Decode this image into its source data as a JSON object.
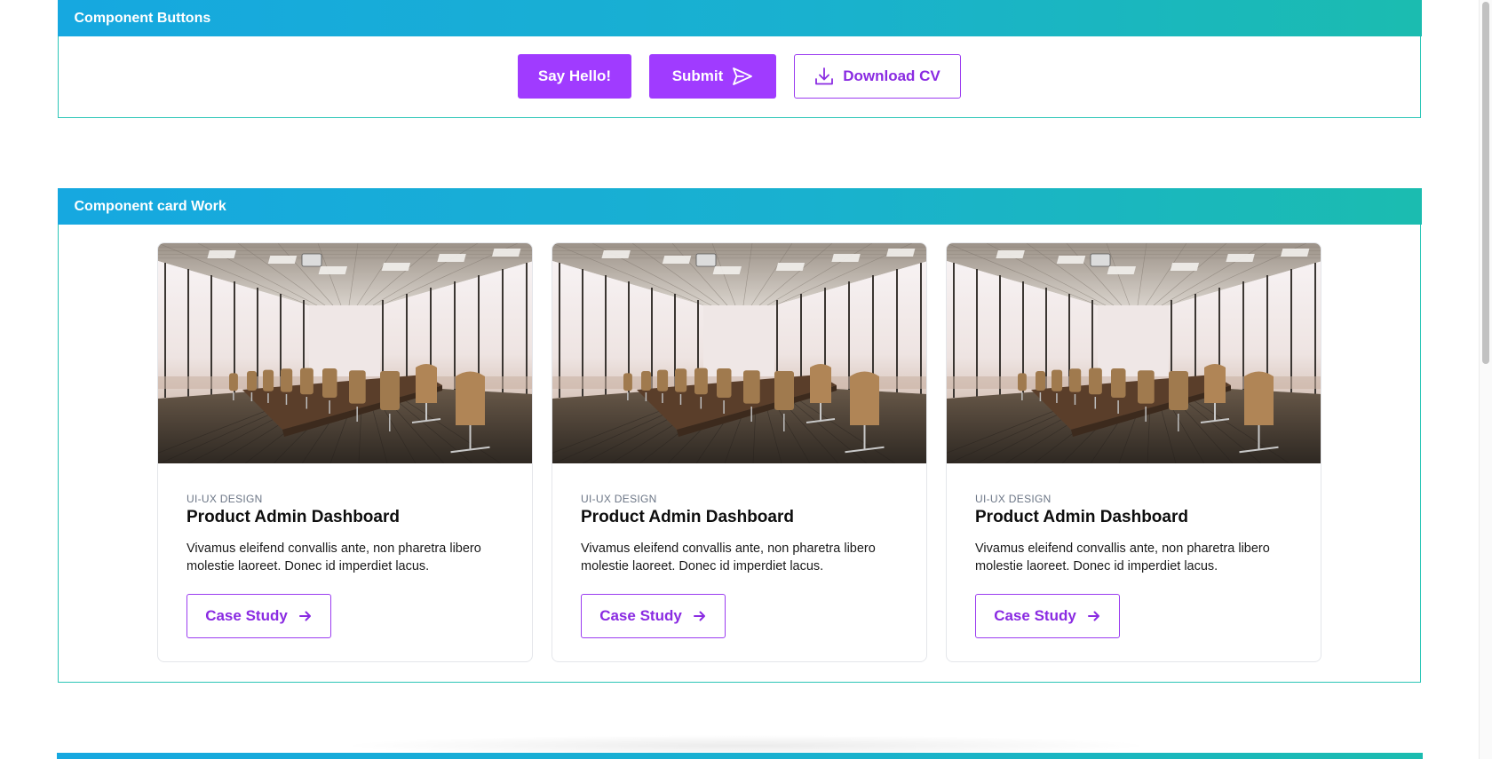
{
  "sections": {
    "buttons": {
      "title": "Component Buttons",
      "say_hello_label": "Say Hello!",
      "submit_label": "Submit",
      "download_label": "Download CV"
    },
    "cards": {
      "title": "Component card Work",
      "items": [
        {
          "category": "UI-UX DESIGN",
          "title": "Product Admin Dashboard",
          "text": "Vivamus eleifend convallis ante, non pharetra libero molestie laoreet. Donec id imperdiet lacus.",
          "button_label": "Case Study"
        },
        {
          "category": "UI-UX DESIGN",
          "title": "Product Admin Dashboard",
          "text": "Vivamus eleifend convallis ante, non pharetra libero molestie laoreet. Donec id imperdiet lacus.",
          "button_label": "Case Study"
        },
        {
          "category": "UI-UX DESIGN",
          "title": "Product Admin Dashboard",
          "text": "Vivamus eleifend convallis ante, non pharetra libero molestie laoreet. Donec id imperdiet lacus.",
          "button_label": "Case Study"
        }
      ]
    }
  },
  "icons": {
    "submit": "send-icon",
    "download": "download-icon",
    "case_study": "arrow-right-icon",
    "card_image": "conference-room-photo"
  },
  "colors": {
    "header_gradient_start": "#16a8e0",
    "header_gradient_end": "#1bbcb0",
    "panel_border": "#2cc6b7",
    "button_primary": "#a03bff",
    "button_outline_text": "#8a2be2"
  }
}
